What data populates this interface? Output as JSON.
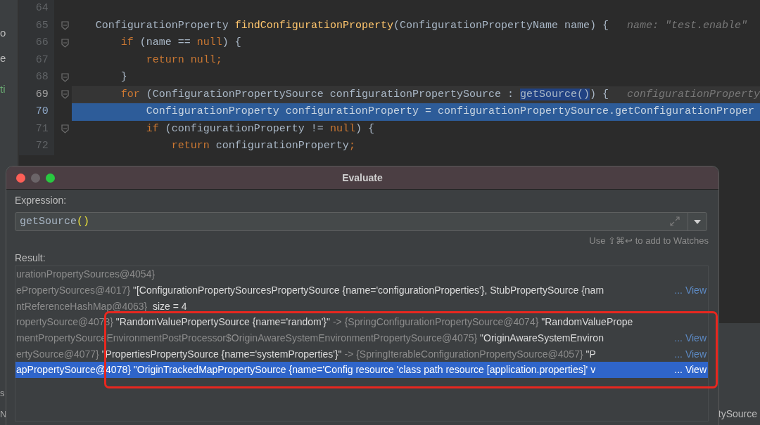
{
  "sidebar": {
    "items": [
      {
        "text": "o",
        "kind": "plain"
      },
      {
        "text": "e",
        "kind": "plain"
      },
      {
        "text": "ti",
        "kind": "green"
      }
    ],
    "lower_items": [
      {
        "text": "s"
      },
      {
        "text": "N"
      }
    ]
  },
  "editor": {
    "lines": [
      {
        "number": "64",
        "current": false,
        "execution": false,
        "fold": false
      },
      {
        "number": "65",
        "current": false,
        "execution": false,
        "fold": true,
        "tokens": [
          {
            "text": "ConfigurationProperty ",
            "kind": "plain"
          },
          {
            "text": "findConfigurationProperty",
            "kind": "method"
          },
          {
            "text": "(ConfigurationPropertyName name) {",
            "kind": "plain"
          },
          {
            "text": "name: \"test.enable\"",
            "kind": "hint"
          }
        ]
      },
      {
        "number": "66",
        "current": false,
        "execution": false,
        "fold": true,
        "tokens": [
          {
            "text": "    if",
            "kind": "keyword"
          },
          {
            "text": " (name == ",
            "kind": "plain"
          },
          {
            "text": "null",
            "kind": "keyword"
          },
          {
            "text": ") {",
            "kind": "plain"
          }
        ]
      },
      {
        "number": "67",
        "current": false,
        "execution": false,
        "fold": false,
        "tokens": [
          {
            "text": "        return null;",
            "kind": "keyword"
          }
        ]
      },
      {
        "number": "68",
        "current": false,
        "execution": false,
        "fold": true,
        "tokens": [
          {
            "text": "    }",
            "kind": "plain"
          }
        ]
      },
      {
        "number": "69",
        "current": true,
        "execution": false,
        "fold": true,
        "tokens": [
          {
            "text": "    for",
            "kind": "keyword"
          },
          {
            "text": " (ConfigurationPropertySource configurationPropertySource : ",
            "kind": "plain"
          },
          {
            "text": "getSource()",
            "kind": "found"
          },
          {
            "text": ") {",
            "kind": "plain"
          },
          {
            "text": "configurationProperty",
            "kind": "hint"
          }
        ]
      },
      {
        "number": "70",
        "current": false,
        "execution": true,
        "fold": false,
        "tokens": [
          {
            "text": "        ConfigurationProperty configurationProperty = configurationPropertySource.getConfigurationProper",
            "kind": "plain"
          }
        ]
      },
      {
        "number": "71",
        "current": false,
        "execution": false,
        "fold": true,
        "tokens": [
          {
            "text": "        if",
            "kind": "keyword"
          },
          {
            "text": " (configurationProperty != ",
            "kind": "plain"
          },
          {
            "text": "null",
            "kind": "keyword"
          },
          {
            "text": ") {",
            "kind": "plain"
          }
        ]
      },
      {
        "number": "72",
        "current": false,
        "execution": false,
        "fold": false,
        "tokens": [
          {
            "text": "            return",
            "kind": "keyword"
          },
          {
            "text": " configurationProperty",
            "kind": "plain"
          },
          {
            "text": ";",
            "kind": "keyword"
          }
        ]
      }
    ]
  },
  "bottom_panel": {
    "text": "tySource"
  },
  "dialog": {
    "title": "Evaluate",
    "expression_label": "Expression:",
    "expression": [
      {
        "text": "getSource",
        "kind": "plain"
      },
      {
        "text": "()",
        "kind": "brace"
      }
    ],
    "hint": "Use ⇧⌘↩ to add to Watches",
    "result_label": "Result:",
    "rows": [
      {
        "selected": false,
        "segments": [
          {
            "text": "urationPropertySources@4054}",
            "kind": "type"
          }
        ]
      },
      {
        "selected": false,
        "segments": [
          {
            "text": "ePropertySources@4017} ",
            "kind": "type"
          },
          {
            "text": "\"[ConfigurationPropertySourcesPropertySource {name='configurationProperties'}, StubPropertySource {nam",
            "kind": "value"
          }
        ],
        "link": "... View"
      },
      {
        "selected": false,
        "segments": [
          {
            "text": "ntReferenceHashMap@4063} ",
            "kind": "type"
          },
          {
            "text": " size = 4",
            "kind": "value"
          }
        ]
      },
      {
        "selected": false,
        "segments": [
          {
            "text": "ropertySource@4073} ",
            "kind": "type"
          },
          {
            "text": "\"RandomValuePropertySource {name='random'}\" ",
            "kind": "value"
          },
          {
            "text": "-> {SpringConfigurationPropertySource@4074} ",
            "kind": "type"
          },
          {
            "text": "\"RandomValuePrope",
            "kind": "value"
          }
        ]
      },
      {
        "selected": false,
        "segments": [
          {
            "text": "mentPropertySourceEnvironmentPostProcessor$OriginAwareSystemEnvironmentPropertySource@4075} ",
            "kind": "type"
          },
          {
            "text": "\"OriginAwareSystemEnviron",
            "kind": "value"
          }
        ],
        "link": "... View"
      },
      {
        "selected": false,
        "segments": [
          {
            "text": "ertySource@4077} ",
            "kind": "type"
          },
          {
            "text": "\"PropertiesPropertySource {name='systemProperties'}\" ",
            "kind": "value"
          },
          {
            "text": "-> {SpringIterableConfigurationPropertySource@4057} ",
            "kind": "type"
          },
          {
            "text": "\"P",
            "kind": "value"
          }
        ],
        "link": "... View"
      },
      {
        "selected": true,
        "segments": [
          {
            "text": "apPropertySource@4078} ",
            "kind": "type"
          },
          {
            "text": "\"OriginTrackedMapPropertySource {name='Config resource 'class path resource [application.properties]' v",
            "kind": "value"
          }
        ],
        "link": "... View"
      }
    ]
  }
}
